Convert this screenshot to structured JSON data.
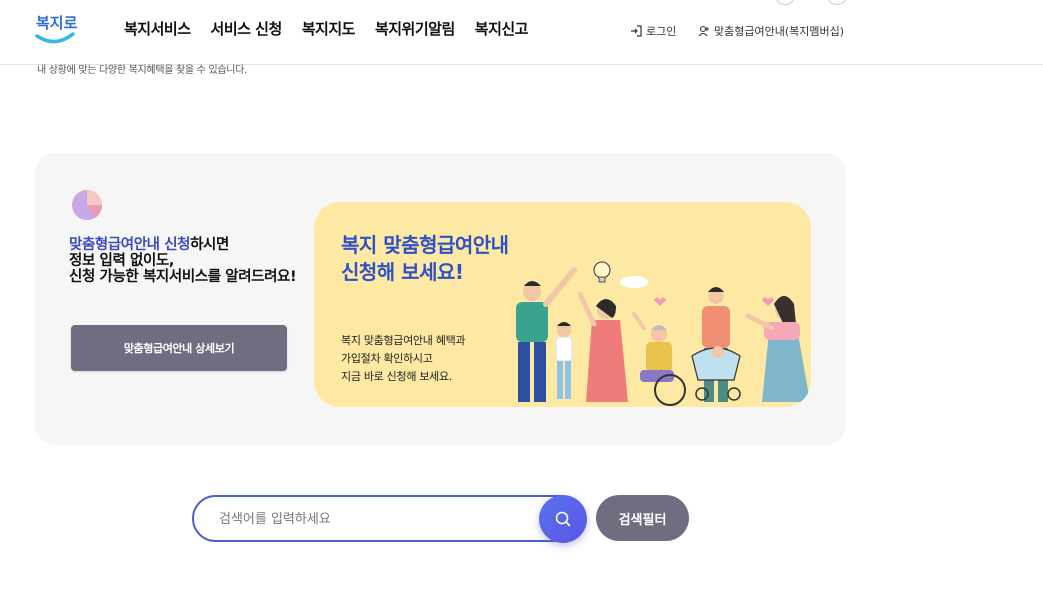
{
  "header": {
    "logo_text": "복지로",
    "nav": [
      "복지서비스",
      "서비스 신청",
      "복지지도",
      "복지위기알림",
      "복지신고"
    ],
    "login_label": "로그인",
    "member_label": "맞춤형급여안내(복지멤버십)"
  },
  "intro_text": "내 상황에 맞는 다양한 복지혜택을 찾을 수 있습니다.",
  "card": {
    "highlight": "맞춤형급여안내 신청",
    "line1_rest": "하시면",
    "line2": "정보 입력 없이도,",
    "line3": "신청 가능한 복지서비스를 알려드려요!",
    "detail_button": "맞춤형급여안내 상세보기"
  },
  "banner": {
    "title_line1": "복지 맞춤형급여안내",
    "title_line2": "신청해 보세요!",
    "desc_line1": "복지 맞춤형급여안내 혜택과",
    "desc_line2": "가입절차 확인하시고",
    "desc_line3": "지금 바로 신청해 보세요."
  },
  "search": {
    "placeholder": "검색어를 입력하세요",
    "filter_label": "검색필터"
  },
  "colors": {
    "primary": "#4a60cf",
    "highlight_text": "#3c4bbd",
    "banner_bg": "#fde9a3",
    "gray_button": "#6e6e80"
  }
}
